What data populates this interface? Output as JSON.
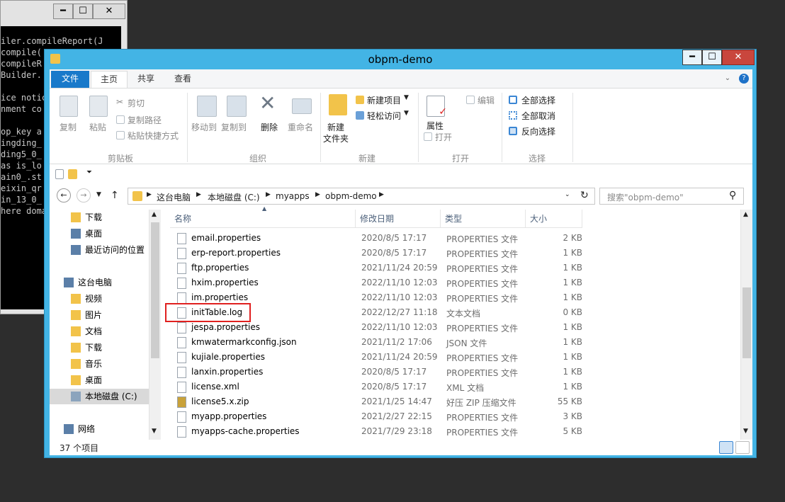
{
  "bg_window": {
    "console_lines": [
      "iler.compileReport(J",
      "compile(",
      "compileR",
      "Builder.",
      "",
      "ice notic",
      "nment co",
      "",
      "op_key a",
      "ingding_",
      "ding5_0_",
      "as is_lo",
      "ain0_.st",
      "eixin_qr",
      "in_13_0_",
      "here doma"
    ]
  },
  "window": {
    "title": "obpm-demo",
    "controls": {
      "minimize": "━",
      "maximize": "☐",
      "close": "✕"
    }
  },
  "tabs": [
    {
      "label": "文件"
    },
    {
      "label": "主页"
    },
    {
      "label": "共享"
    },
    {
      "label": "查看"
    }
  ],
  "ribbon": {
    "copy": "复制",
    "paste": "粘贴",
    "cut": "剪切",
    "copy_path": "复制路径",
    "paste_shortcut": "粘贴快捷方式",
    "group_clipboard": "剪贴板",
    "move_to": "移动到",
    "copy_to": "复制到",
    "delete": "删除",
    "rename": "重命名",
    "group_organize": "组织",
    "new_folder_1": "新建",
    "new_folder_2": "文件夹",
    "new_item": "新建项目",
    "easy_access": "轻松访问",
    "group_new": "新建",
    "properties": "属性",
    "open": "打开",
    "edit": "编辑",
    "group_open": "打开",
    "select_all": "全部选择",
    "select_none": "全部取消",
    "invert_selection": "反向选择",
    "group_select": "选择"
  },
  "breadcrumb": [
    "这台电脑",
    "本地磁盘 (C:)",
    "myapps",
    "obpm-demo"
  ],
  "search": {
    "placeholder": "搜索\"obpm-demo\""
  },
  "nav": {
    "items": [
      {
        "label": "下载",
        "icon": "download-folder-icon"
      },
      {
        "label": "桌面",
        "icon": "desktop-icon"
      },
      {
        "label": "最近访问的位置",
        "icon": "recent-places-icon"
      },
      {
        "label": "这台电脑",
        "icon": "computer-icon"
      },
      {
        "label": "视频",
        "icon": "videos-folder-icon"
      },
      {
        "label": "图片",
        "icon": "pictures-folder-icon"
      },
      {
        "label": "文档",
        "icon": "documents-folder-icon"
      },
      {
        "label": "下载",
        "icon": "download-folder-icon"
      },
      {
        "label": "音乐",
        "icon": "music-folder-icon"
      },
      {
        "label": "桌面",
        "icon": "desktop-folder-icon"
      },
      {
        "label": "本地磁盘 (C:)",
        "icon": "drive-icon"
      },
      {
        "label": "网络",
        "icon": "network-icon"
      }
    ]
  },
  "columns": {
    "name": "名称",
    "date": "修改日期",
    "type": "类型",
    "size": "大小"
  },
  "files": [
    {
      "name": "email.properties",
      "date": "2020/8/5 17:17",
      "type": "PROPERTIES 文件",
      "size": "2 KB"
    },
    {
      "name": "erp-report.properties",
      "date": "2020/8/5 17:17",
      "type": "PROPERTIES 文件",
      "size": "1 KB"
    },
    {
      "name": "ftp.properties",
      "date": "2021/11/24 20:59",
      "type": "PROPERTIES 文件",
      "size": "1 KB"
    },
    {
      "name": "hxim.properties",
      "date": "2022/11/10 12:03",
      "type": "PROPERTIES 文件",
      "size": "1 KB"
    },
    {
      "name": "im.properties",
      "date": "2022/11/10 12:03",
      "type": "PROPERTIES 文件",
      "size": "1 KB"
    },
    {
      "name": "initTable.log",
      "date": "2022/12/27 11:18",
      "type": "文本文档",
      "size": "0 KB"
    },
    {
      "name": "jespa.properties",
      "date": "2022/11/10 12:03",
      "type": "PROPERTIES 文件",
      "size": "1 KB"
    },
    {
      "name": "kmwatermarkconfig.json",
      "date": "2021/11/2 17:06",
      "type": "JSON 文件",
      "size": "1 KB"
    },
    {
      "name": "kujiale.properties",
      "date": "2021/11/24 20:59",
      "type": "PROPERTIES 文件",
      "size": "1 KB"
    },
    {
      "name": "lanxin.properties",
      "date": "2020/8/5 17:17",
      "type": "PROPERTIES 文件",
      "size": "1 KB"
    },
    {
      "name": "license.xml",
      "date": "2020/8/5 17:17",
      "type": "XML 文档",
      "size": "1 KB"
    },
    {
      "name": "license5.x.zip",
      "date": "2021/1/25 14:47",
      "type": "好压 ZIP 压缩文件",
      "size": "55 KB"
    },
    {
      "name": "myapp.properties",
      "date": "2021/2/27 22:15",
      "type": "PROPERTIES 文件",
      "size": "3 KB"
    },
    {
      "name": "myapps-cache.properties",
      "date": "2021/7/29 23:18",
      "type": "PROPERTIES 文件",
      "size": "5 KB"
    }
  ],
  "status": {
    "item_count": "37 个项目"
  },
  "colors": {
    "window_border": "#43b4e5",
    "file_tab": "#1979ca",
    "highlight": "#e0201f"
  }
}
